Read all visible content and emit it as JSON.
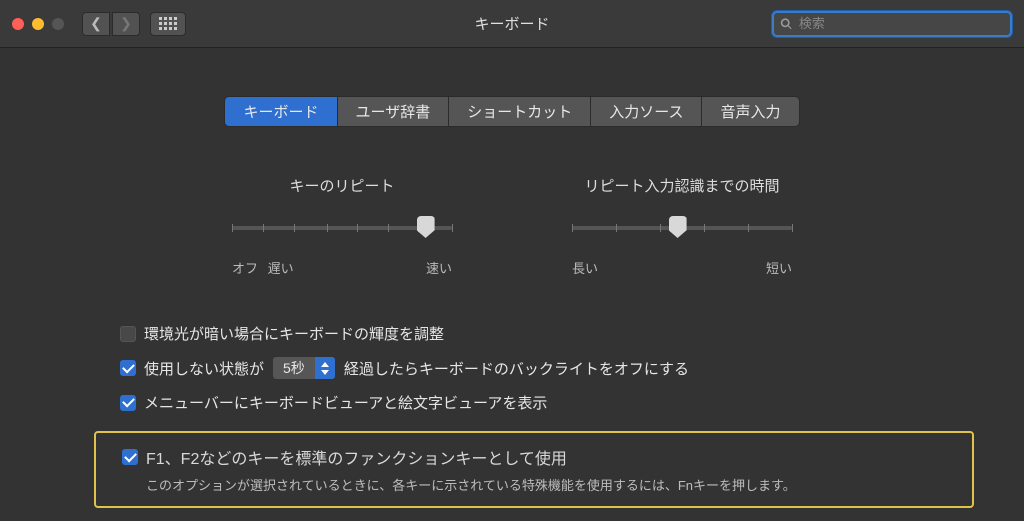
{
  "window": {
    "title": "キーボード"
  },
  "search": {
    "placeholder": "検索"
  },
  "tabs": [
    "キーボード",
    "ユーザ辞書",
    "ショートカット",
    "入力ソース",
    "音声入力"
  ],
  "sliders": {
    "key_repeat": {
      "title": "キーのリピート",
      "left_label_1": "オフ",
      "left_label_2": "遅い",
      "right_label": "速い",
      "value_percent": 88
    },
    "delay": {
      "title": "リピート入力認識までの時間",
      "left_label": "長い",
      "right_label": "短い",
      "value_percent": 48
    }
  },
  "options": {
    "ambient": {
      "checked": false,
      "label": "環境光が暗い場合にキーボードの輝度を調整"
    },
    "backlight": {
      "checked": true,
      "prefix": "使用しない状態が",
      "select_value": "5秒",
      "suffix": "経過したらキーボードのバックライトをオフにする"
    },
    "menubar": {
      "checked": true,
      "label": "メニューバーにキーボードビューアと絵文字ビューアを表示"
    },
    "fn_keys": {
      "checked": true,
      "label": "F1、F2などのキーを標準のファンクションキーとして使用",
      "hint": "このオプションが選択されているときに、各キーに示されている特殊機能を使用するには、Fnキーを押します。"
    }
  }
}
